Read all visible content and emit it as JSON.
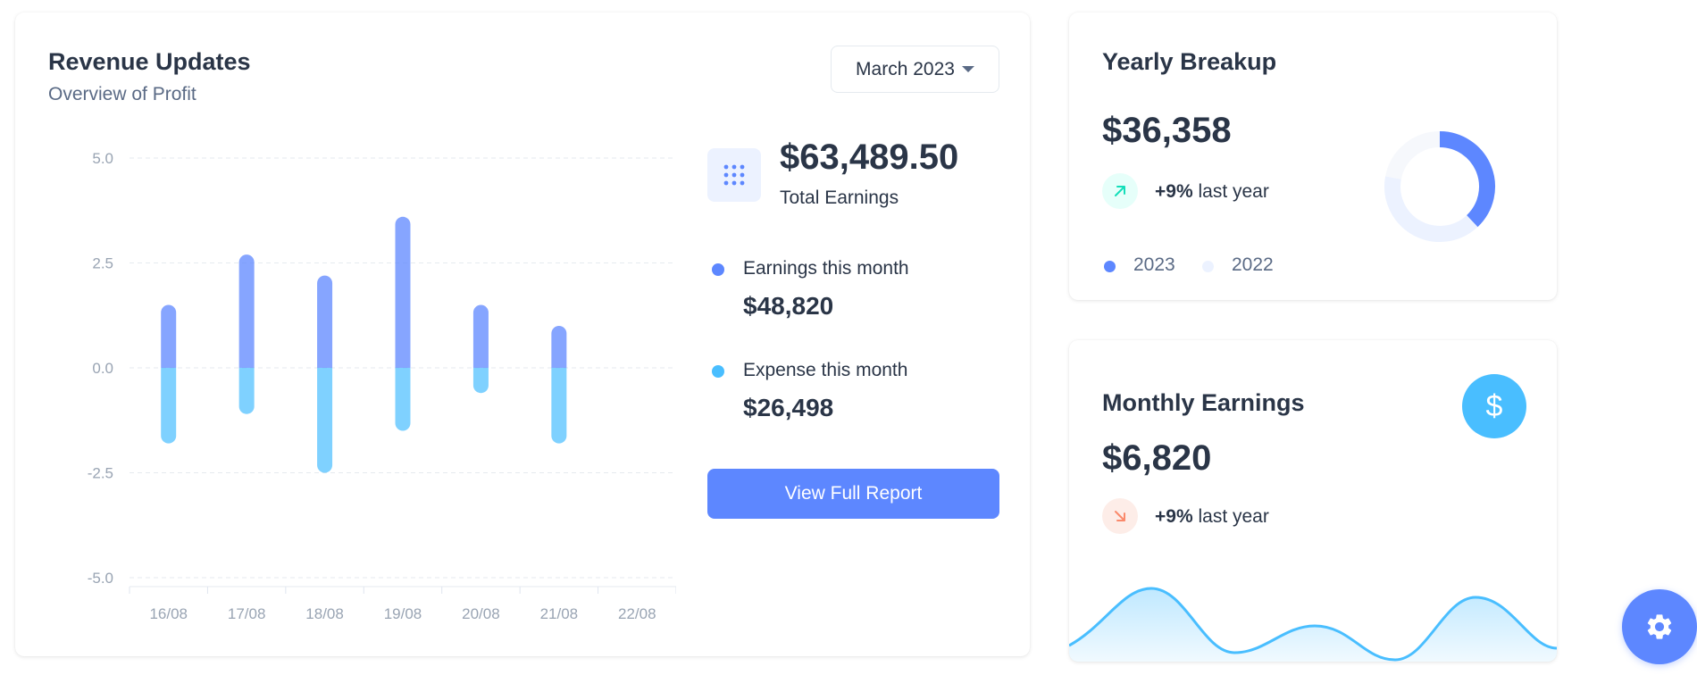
{
  "revenue": {
    "title": "Revenue Updates",
    "subtitle": "Overview of Profit",
    "date_filter": "March 2023",
    "total_earnings_value": "$63,489.50",
    "total_earnings_label": "Total Earnings",
    "earnings_label": "Earnings this month",
    "earnings_value": "$48,820",
    "expense_label": "Expense this month",
    "expense_value": "$26,498",
    "report_button": "View Full Report"
  },
  "chart_data": {
    "type": "bar",
    "categories": [
      "16/08",
      "17/08",
      "18/08",
      "19/08",
      "20/08",
      "21/08",
      "22/08"
    ],
    "series": [
      {
        "values": [
          1.5,
          2.7,
          2.2,
          3.6,
          1.5,
          1.0,
          0
        ]
      },
      {
        "values": [
          -1.8,
          -1.1,
          -2.5,
          -1.5,
          -0.6,
          -1.8,
          0
        ]
      }
    ],
    "ylim": [
      -5,
      5
    ],
    "yticks": [
      "5.0",
      "2.5",
      "0.0",
      "-2.5",
      "-5.0"
    ],
    "ytick_values": [
      5,
      2.5,
      0,
      -2.5,
      -5
    ],
    "grid": true,
    "colors": [
      "#5D87FF",
      "#49BEFF"
    ]
  },
  "yearly": {
    "title": "Yearly Breakup",
    "value": "$36,358",
    "trend_percent": "+9%",
    "trend_text": "last year",
    "legend": [
      {
        "label": "2023",
        "color": "#5D87FF"
      },
      {
        "label": "2022",
        "color": "#ECF2FF"
      }
    ],
    "donut_values": [
      38,
      40,
      22
    ]
  },
  "monthly": {
    "title": "Monthly Earnings",
    "value": "$6,820",
    "trend_percent": "+9%",
    "trend_text": "last year",
    "currency_icon": "$"
  },
  "colors": {
    "primary": "#5D87FF",
    "secondary": "#49BEFF",
    "success_light": "#E6FFFA",
    "success": "#13DEB9",
    "error_light": "#FDEDE8",
    "error": "#FA896B"
  }
}
